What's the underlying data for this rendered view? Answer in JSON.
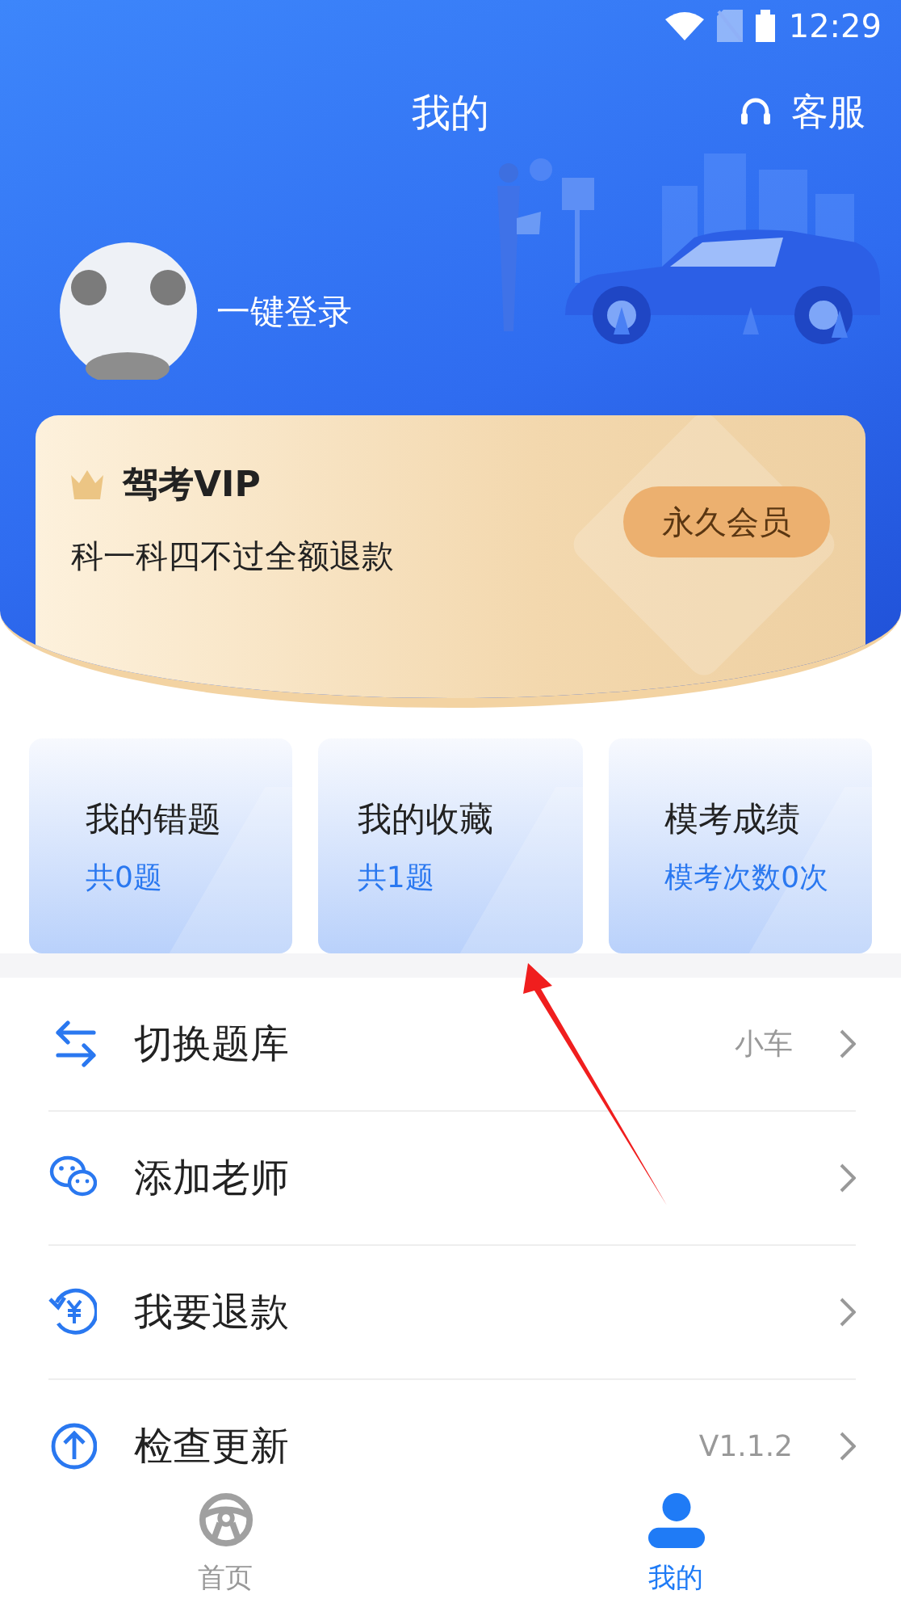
{
  "status_bar": {
    "time": "12:29"
  },
  "header": {
    "title": "我的",
    "service": "客服"
  },
  "profile": {
    "login": "一键登录"
  },
  "vip": {
    "title": "驾考VIP",
    "subtitle": "科一科四不过全额退款",
    "badge": "永久会员"
  },
  "stats": [
    {
      "title": "我的错题",
      "value": "共0题"
    },
    {
      "title": "我的收藏",
      "value": "共1题"
    },
    {
      "title": "模考成绩",
      "value": "模考次数0次"
    }
  ],
  "menu": [
    {
      "kind": "switch",
      "label": "切换题库",
      "value": "小车"
    },
    {
      "kind": "wechat",
      "label": "添加老师"
    },
    {
      "kind": "refund",
      "label": "我要退款"
    },
    {
      "kind": "update",
      "label": "检查更新",
      "value": "V1.1.2"
    }
  ],
  "nav": [
    {
      "kind": "home",
      "label": "首页",
      "selected": false
    },
    {
      "kind": "profile",
      "label": "我的",
      "selected": true
    }
  ]
}
